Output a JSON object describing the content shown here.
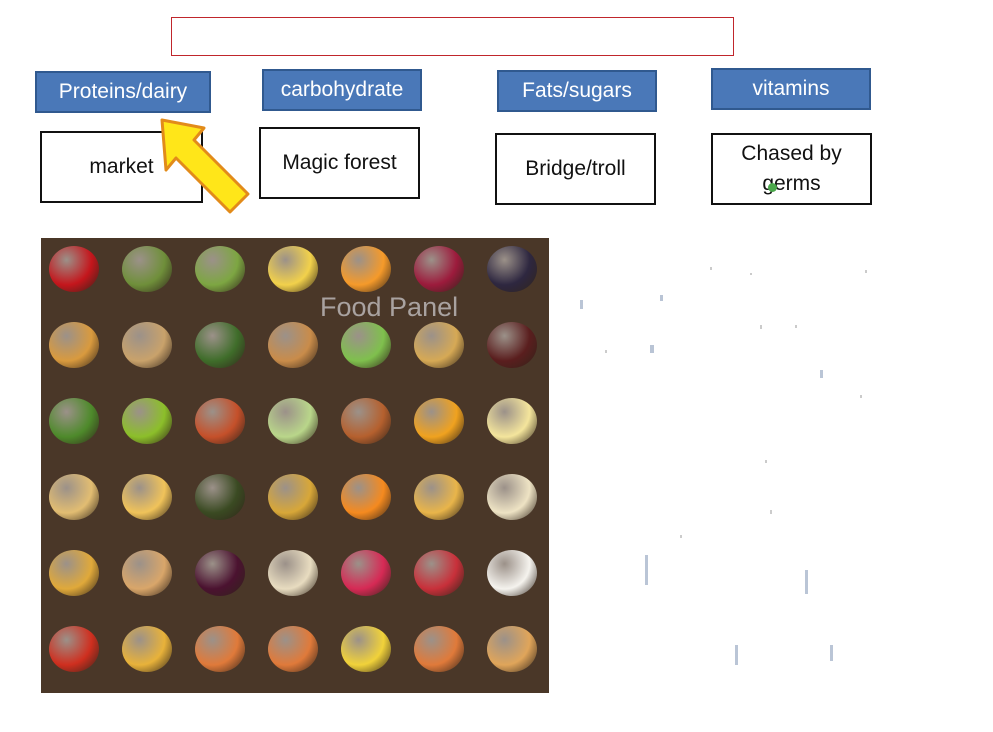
{
  "title_box": {
    "text": ""
  },
  "categories": [
    {
      "label": "Proteins/dairy"
    },
    {
      "label": "carbohydrate"
    },
    {
      "label": "Fats/sugars"
    },
    {
      "label": "vitamins"
    }
  ],
  "places": [
    {
      "label": "market"
    },
    {
      "label": "Magic forest"
    },
    {
      "label": "Bridge/troll"
    },
    {
      "label": "Chased by germs"
    }
  ],
  "food_panel": {
    "label": "Food Panel",
    "items": [
      {
        "name": "apple-icon",
        "color": "#c4161c"
      },
      {
        "name": "asparagus-icon",
        "color": "#6f8f3a"
      },
      {
        "name": "avocado-icon",
        "color": "#7da642"
      },
      {
        "name": "banana-icon",
        "color": "#f2d14b"
      },
      {
        "name": "apricot-icon",
        "color": "#f59a2a"
      },
      {
        "name": "beetroot-icon",
        "color": "#9c1b3c"
      },
      {
        "name": "blackberry-icon",
        "color": "#2e2740"
      },
      {
        "name": "chicken-nuggets-icon",
        "color": "#d99a3e"
      },
      {
        "name": "pie-slice-icon",
        "color": "#c9a26b"
      },
      {
        "name": "zucchini-icon",
        "color": "#3f6d2a"
      },
      {
        "name": "pancake-icon",
        "color": "#c98c4a"
      },
      {
        "name": "cucumber-icon",
        "color": "#7fc04d"
      },
      {
        "name": "rice-dish-icon",
        "color": "#d6a955"
      },
      {
        "name": "dates-icon",
        "color": "#5a1e1e"
      },
      {
        "name": "kale-icon",
        "color": "#4e8a2b"
      },
      {
        "name": "kiwi-icon",
        "color": "#8cbf2a"
      },
      {
        "name": "lasagna-icon",
        "color": "#c5502a"
      },
      {
        "name": "leek-icon",
        "color": "#b9d68a"
      },
      {
        "name": "lentils-icon",
        "color": "#b5602e"
      },
      {
        "name": "mango-icon",
        "color": "#f0a21f"
      },
      {
        "name": "mayonnaise-icon",
        "color": "#f4e59c"
      },
      {
        "name": "potatoes-icon",
        "color": "#e2bd72"
      },
      {
        "name": "grated-cheese-icon",
        "color": "#f0c35a"
      },
      {
        "name": "olives-icon",
        "color": "#3a4a22"
      },
      {
        "name": "samosa-icon",
        "color": "#d8a738"
      },
      {
        "name": "oranges-icon",
        "color": "#f58a1f"
      },
      {
        "name": "fries-icon",
        "color": "#e9b54a"
      },
      {
        "name": "parsnip-icon",
        "color": "#eee3c4"
      },
      {
        "name": "pineapple-icon",
        "color": "#e0a93a"
      },
      {
        "name": "pita-bread-icon",
        "color": "#d9a66a"
      },
      {
        "name": "plums-icon",
        "color": "#4b1230"
      },
      {
        "name": "porridge-icon",
        "color": "#e8dcc0"
      },
      {
        "name": "raspberries-icon",
        "color": "#d62a55"
      },
      {
        "name": "rhubarb-icon",
        "color": "#c8303a"
      },
      {
        "name": "rice-bowl-icon",
        "color": "#f5f3ee"
      },
      {
        "name": "tomato-soup-icon",
        "color": "#cf2f1f"
      },
      {
        "name": "macaroni-icon",
        "color": "#e8b23a"
      },
      {
        "name": "spaghetti-plate-icon",
        "color": "#e07a3a"
      },
      {
        "name": "spaghetti-plate-icon",
        "color": "#e07a3a"
      },
      {
        "name": "corn-icon",
        "color": "#f1d23a"
      },
      {
        "name": "spaghetti-plate-icon",
        "color": "#e07a3a"
      },
      {
        "name": "toast-icon",
        "color": "#e0a55a"
      }
    ]
  }
}
